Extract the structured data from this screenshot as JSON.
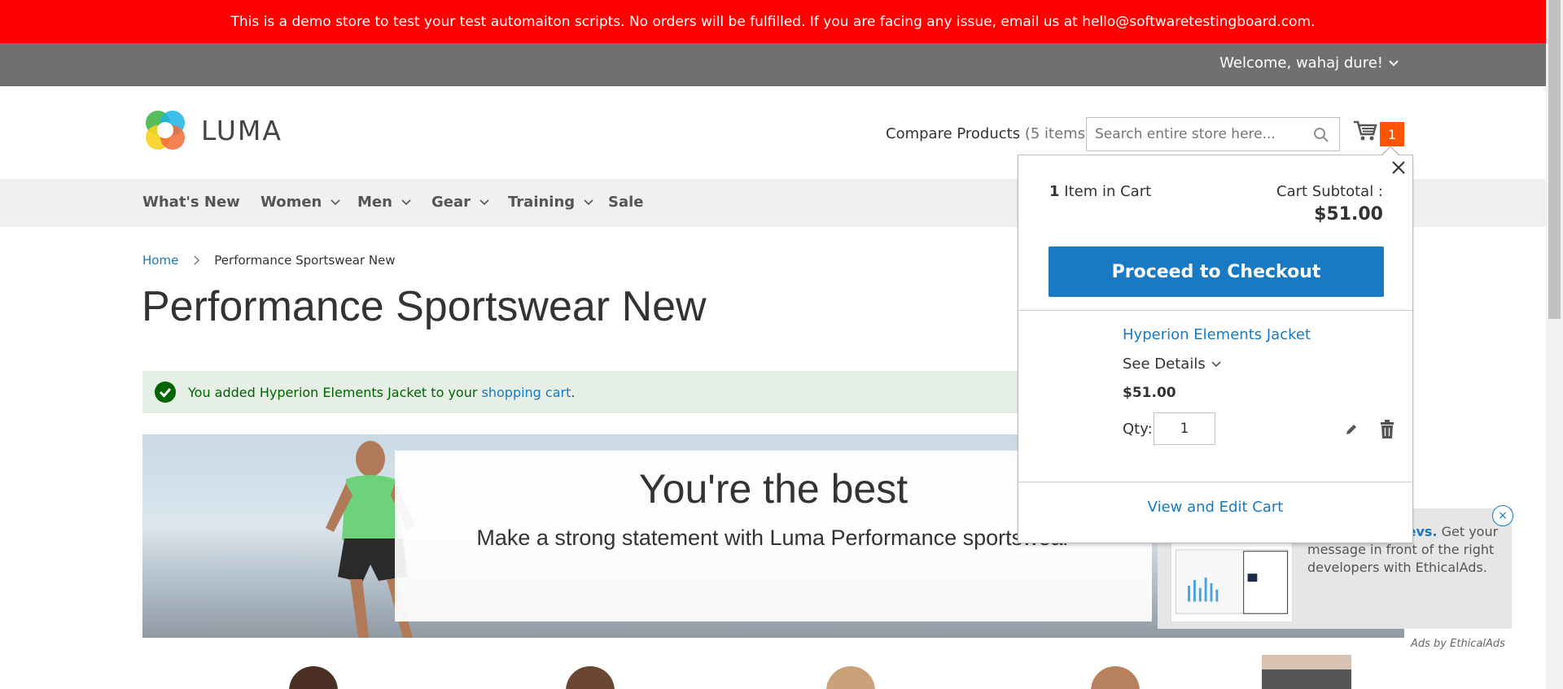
{
  "demo_notice": "This is a demo store to test your test automaiton scripts. No orders will be fulfilled. If you are facing any issue, email us at hello@softwaretestingboard.com.",
  "account": {
    "welcome": "Welcome, wahaj dure!"
  },
  "logo": {
    "text": "LUMA"
  },
  "header": {
    "compare_label": "Compare Products",
    "compare_count": "(5 items)",
    "search_placeholder": "Search entire store here...",
    "cart_count": "1"
  },
  "nav": [
    "What's New",
    "Women",
    "Men",
    "Gear",
    "Training",
    "Sale"
  ],
  "breadcrumb": {
    "home": "Home",
    "current": "Performance Sportswear New"
  },
  "page_title": "Performance Sportswear New",
  "message": {
    "prefix": "You added Hyperion Elements Jacket to your",
    "link": "shopping cart",
    "suffix": "."
  },
  "hero": {
    "title": "You're the best",
    "subtitle": "Make a strong statement with Luma Performance sportswear"
  },
  "minicart": {
    "count_num": "1",
    "count_label": "Item in Cart",
    "subtotal_label": "Cart Subtotal :",
    "subtotal_value": "$51.00",
    "checkout_label": "Proceed to Checkout",
    "item": {
      "name": "Hyperion Elements Jacket",
      "details": "See Details",
      "price": "$51.00",
      "qty_label": "Qty:",
      "qty": "1"
    },
    "view_edit": "View and Edit Cart"
  },
  "ad": {
    "bold": "network for devs.",
    "text": "Get your message in front of the right developers with EthicalAds.",
    "by": "Ads by EthicalAds",
    "close": "×"
  },
  "colors": {
    "demo_bar": "#ff0000",
    "welcome_bar": "#6e716e",
    "accent": "#1979c3",
    "cart_badge": "#ff5501",
    "success_bg": "#e5efe5"
  },
  "icons": [
    "chevron-down-icon",
    "search-icon",
    "cart-icon",
    "close-icon",
    "check-icon",
    "pencil-icon",
    "trash-icon"
  ]
}
